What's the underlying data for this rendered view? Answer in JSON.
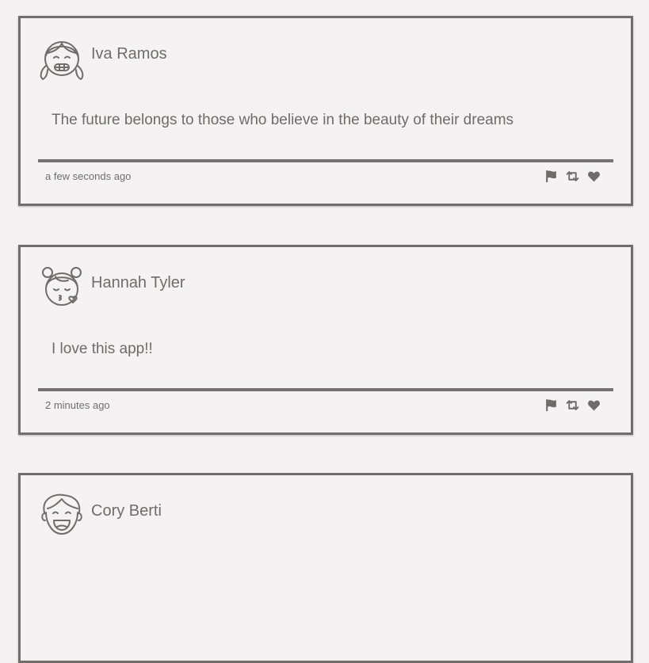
{
  "comments": [
    {
      "name": "Iva Ramos",
      "message": "The future belongs to those who believe in the beauty of their dreams",
      "time": "a few seconds ago",
      "avatar_icon": "girl-braids-grin-icon"
    },
    {
      "name": "Hannah Tyler",
      "message": "I love this app!!",
      "time": "2 minutes ago",
      "avatar_icon": "girl-buns-kiss-icon"
    },
    {
      "name": "Cory Berti",
      "message": "",
      "time": "",
      "avatar_icon": "boy-laugh-icon"
    }
  ],
  "action_icons": [
    "flag-icon",
    "retweet-icon",
    "heart-icon"
  ],
  "colors": {
    "background": "#f3f1f1",
    "border": "#716d6a",
    "text": "#6f6b68"
  }
}
